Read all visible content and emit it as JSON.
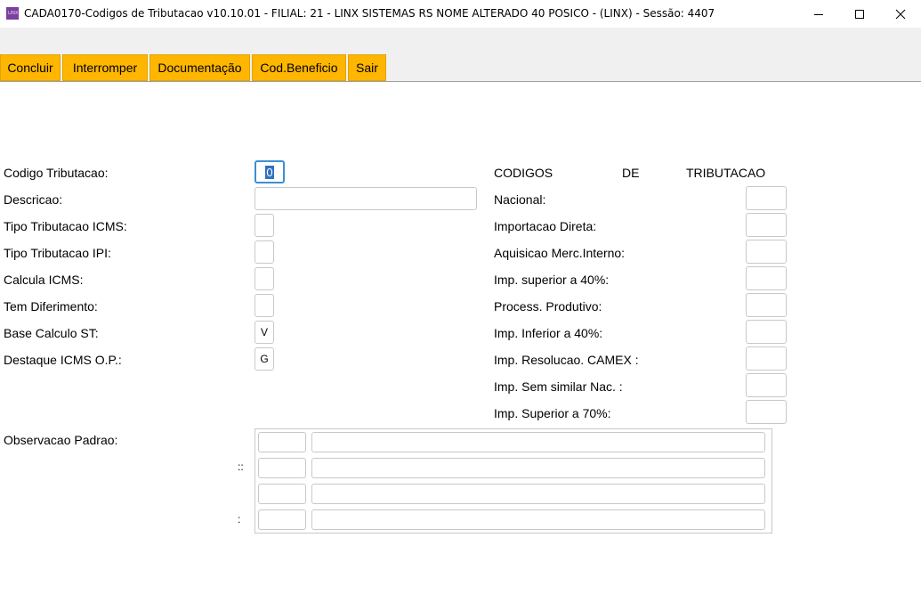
{
  "window": {
    "title": "CADA0170-Codigos de Tributacao v10.10.01   - FILIAL: 21 - LINX SISTEMAS RS NOME ALTERADO 40 POSICO - (LINX) - Sessão: 4407",
    "icon_text": "LINX"
  },
  "toolbar": {
    "buttons": [
      "Concluir",
      "Interromper",
      "Documentação",
      "Cod.Beneficio",
      "Sair"
    ]
  },
  "form": {
    "left_labels": {
      "codigo": "Codigo Tributacao:",
      "descricao": "Descricao:",
      "tipo_icms": "Tipo Tributacao ICMS:",
      "tipo_ipi": "Tipo Tributacao IPI:",
      "calcula_icms": "Calcula ICMS:",
      "diferimento": "Tem Diferimento:",
      "base_st": "Base Calculo ST:",
      "destaque": "Destaque ICMS O.P.:",
      "observacao": "Observacao Padrao:"
    },
    "values": {
      "codigo": "0",
      "descricao": "",
      "tipo_icms": "",
      "tipo_ipi": "",
      "calcula_icms": "",
      "diferimento": "",
      "base_st": "V",
      "destaque": "G"
    },
    "header_words": [
      "CODIGOS",
      "DE",
      "TRIBUTACAO"
    ],
    "right_labels": [
      "Nacional:",
      "Importacao Direta:",
      "Aquisicao Merc.Interno:",
      "Imp. superior a 40%:",
      "Process. Produtivo:",
      "Imp. Inferior a 40%:",
      "Imp. Resolucao. CAMEX :",
      "Imp. Sem similar Nac. :",
      "Imp. Superior a 70%:"
    ],
    "obs_separators": [
      "::",
      ":"
    ]
  },
  "colors": {
    "accent": "#ffb600",
    "focus": "#3c8fd6"
  }
}
